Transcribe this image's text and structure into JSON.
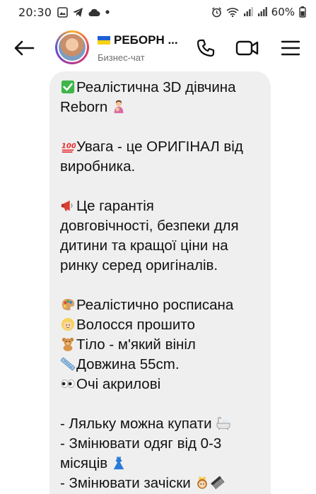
{
  "status_bar": {
    "time": "20:30",
    "battery": "60%",
    "left_icons": [
      "image-icon",
      "telegram-icon",
      "cloud-icon",
      "dot-icon"
    ],
    "right_icons": [
      "alarm-icon",
      "wifi-icon",
      "signal-icon",
      "signal-icon",
      "battery-icon"
    ]
  },
  "header": {
    "title": "РЕБОРН ...",
    "subtitle": "Бизнес-чат",
    "icons": [
      "back-arrow-icon",
      "avatar",
      "ukraine-flag-icon",
      "phone-icon",
      "video-call-icon",
      "menu-icon"
    ]
  },
  "message": {
    "lines": [
      {
        "emoji": "check-mark-icon",
        "text": "Реалістична 3D дівчина"
      },
      {
        "text": "Reborn",
        "emoji_after": "woman-feeding-baby-icon"
      },
      {
        "spacer": true
      },
      {
        "emoji": "hundred-points-icon",
        "text": "Увага - це ОРИГІНАЛ від"
      },
      {
        "text": "виробника."
      },
      {
        "spacer": true
      },
      {
        "emoji": "megaphone-icon",
        "text": "Це гарантія"
      },
      {
        "text": "довговічності, безпеки для"
      },
      {
        "text": "дитини та кращої ціни на"
      },
      {
        "text": "ринку серед оригіналів."
      },
      {
        "spacer": true
      },
      {
        "emoji": "artist-palette-icon",
        "text": "Реалістично росписана"
      },
      {
        "emoji": "blonde-person-icon",
        "text": "Волосся прошито"
      },
      {
        "emoji": "teddy-bear-icon",
        "text": "Тіло - м'який вініл"
      },
      {
        "emoji": "ruler-icon",
        "text": "Довжина 55cm."
      },
      {
        "emoji": "eyes-icon",
        "text": "Очі акрилові"
      },
      {
        "spacer": true
      },
      {
        "text": "- Ляльку можна купати",
        "emoji_after": "bathtub-icon"
      },
      {
        "text": "- Змінювати одяг від 0-3"
      },
      {
        "text": "місяців",
        "emoji_after": "dress-icon"
      },
      {
        "text": "- Змінювати зачіски",
        "emoji_after": "princess-and-comb-icon"
      }
    ]
  }
}
